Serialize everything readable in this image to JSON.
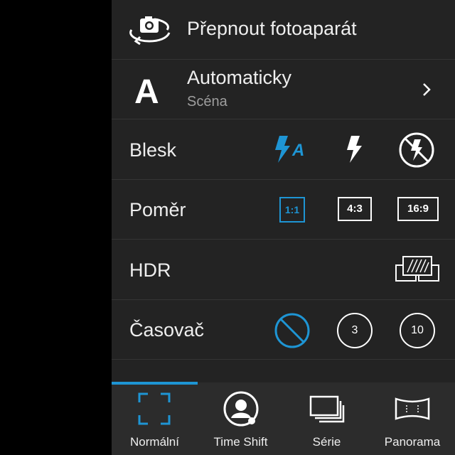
{
  "switch_camera": {
    "label": "Přepnout fotoaparát",
    "icon": "switch-camera-icon"
  },
  "scene": {
    "letter": "A",
    "title": "Automaticky",
    "subtitle": "Scéna"
  },
  "flash": {
    "label": "Blesk",
    "options": [
      "flash-auto-icon",
      "flash-on-icon",
      "flash-off-icon"
    ],
    "selected": "flash-auto"
  },
  "ratio": {
    "label": "Poměr",
    "options": [
      "1:1",
      "4:3",
      "16:9"
    ],
    "selected": "1:1"
  },
  "hdr": {
    "label": "HDR",
    "icon": "hdr-icon"
  },
  "timer": {
    "label": "Časovač",
    "options": [
      "3",
      "10"
    ],
    "selected": "off"
  },
  "tabs": [
    {
      "label": "Normální",
      "icon": "normal-frame-icon",
      "active": true
    },
    {
      "label": "Time Shift",
      "icon": "time-shift-icon",
      "active": false
    },
    {
      "label": "Série",
      "icon": "burst-icon",
      "active": false
    },
    {
      "label": "Panorama",
      "icon": "panorama-icon",
      "active": false
    }
  ],
  "colors": {
    "accent": "#1e95d4",
    "panel": "#232323",
    "bar": "#2c2c2c",
    "background": "#000000"
  }
}
